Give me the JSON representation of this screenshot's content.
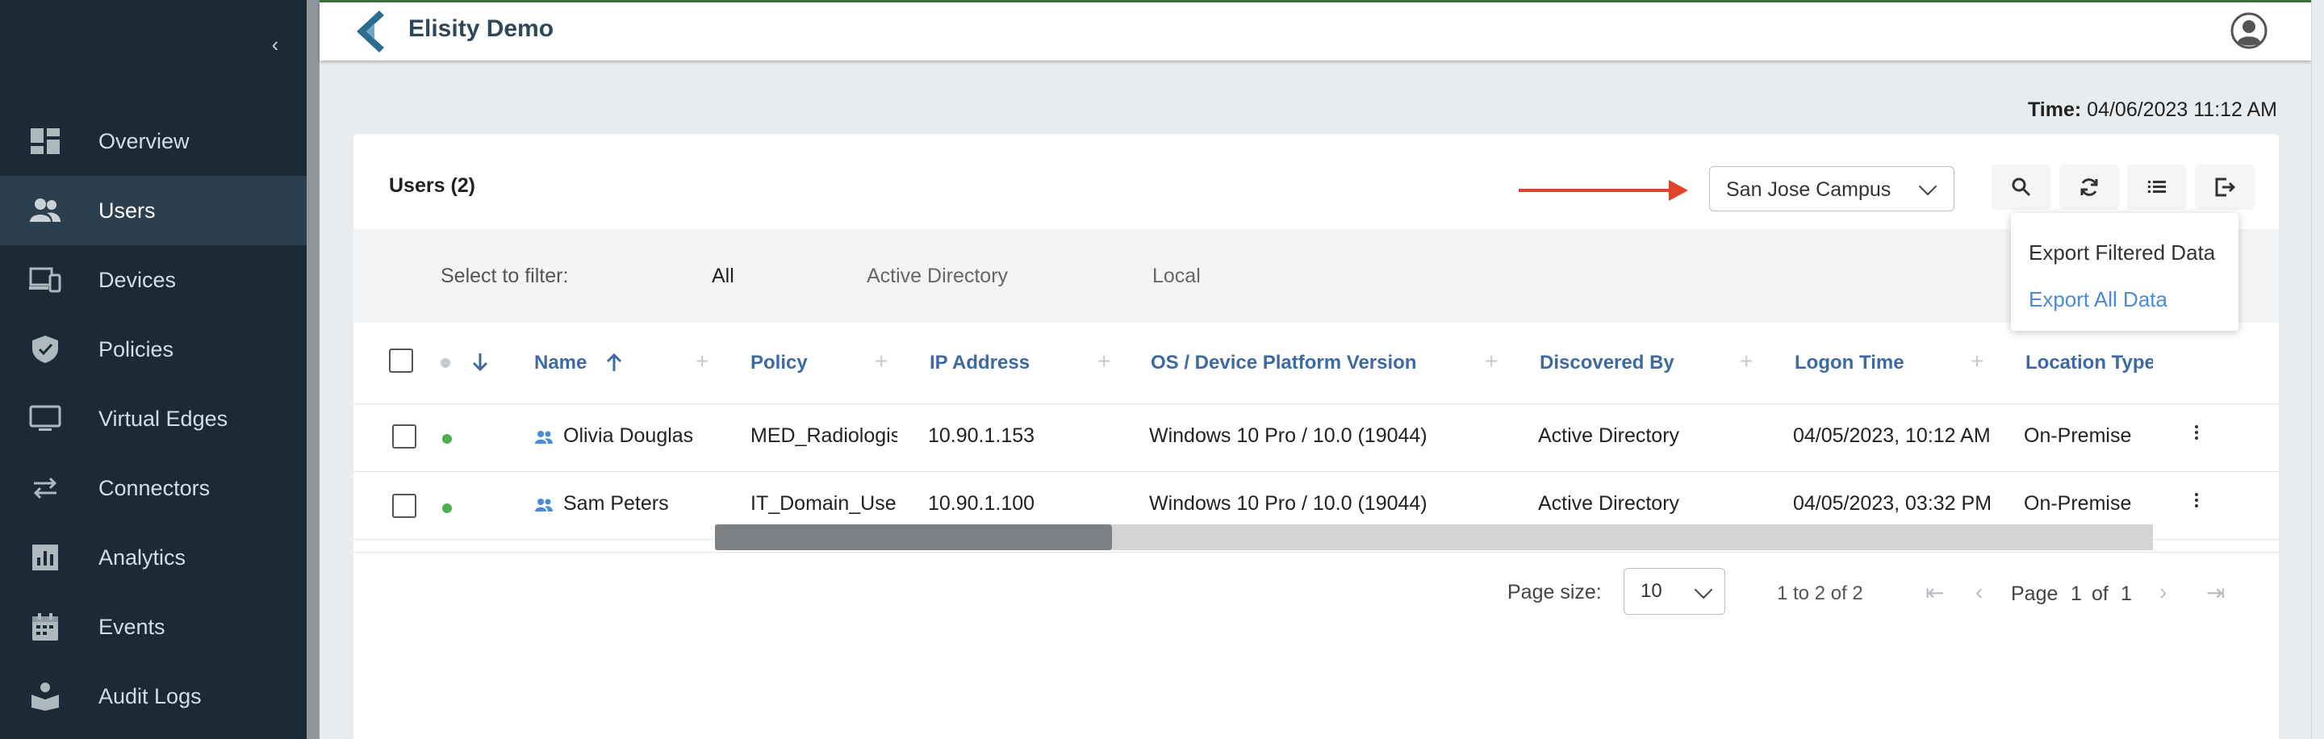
{
  "app": {
    "title": "Elisity Demo"
  },
  "sidebar": {
    "items": [
      {
        "label": "Overview",
        "icon": "dashboard-icon"
      },
      {
        "label": "Users",
        "icon": "users-icon",
        "active": true
      },
      {
        "label": "Devices",
        "icon": "devices-icon"
      },
      {
        "label": "Policies",
        "icon": "shield-icon"
      },
      {
        "label": "Virtual Edges",
        "icon": "monitor-icon"
      },
      {
        "label": "Connectors",
        "icon": "swap-arrows-icon"
      },
      {
        "label": "Analytics",
        "icon": "bar-chart-icon"
      },
      {
        "label": "Events",
        "icon": "calendar-icon"
      },
      {
        "label": "Audit Logs",
        "icon": "book-reader-icon"
      }
    ]
  },
  "time": {
    "label": "Time:",
    "value": "04/06/2023 11:12 AM"
  },
  "panel": {
    "title": "Users (2)",
    "site_select": "San Jose Campus",
    "toolbar": {
      "search": "search-icon",
      "refresh": "refresh-icon",
      "columns": "list-icon",
      "export": "export-icon"
    },
    "export_menu": [
      "Export Filtered Data",
      "Export All Data"
    ]
  },
  "filter": {
    "label": "Select to filter:",
    "tabs": [
      "All",
      "Active Directory",
      "Local"
    ],
    "active_tab": "All"
  },
  "table": {
    "columns": [
      "Name",
      "Policy",
      "IP Address",
      "OS /  Device Platform Version",
      "Discovered By",
      "Logon Time",
      "Location Type"
    ],
    "sort": {
      "column": "Name",
      "direction": "ascending"
    },
    "rows": [
      {
        "name": "Olivia Douglas",
        "policy": "MED_Radiologist",
        "ip": "10.90.1.153",
        "os": "Windows 10 Pro / 10.0 (19044)",
        "discovered_by": "Active Directory",
        "logon_time": "04/05/2023, 10:12 AM",
        "location_type": "On-Premise",
        "status_color": "#4caf50"
      },
      {
        "name": "Sam Peters",
        "policy": "IT_Domain_User",
        "ip": "10.90.1.100",
        "os": "Windows 10 Pro / 10.0 (19044)",
        "discovered_by": "Active Directory",
        "logon_time": "04/05/2023, 03:32 PM",
        "location_type": "On-Premise",
        "status_color": "#4caf50"
      }
    ]
  },
  "pagination": {
    "page_size_label": "Page size:",
    "page_size": "10",
    "range": "1 to 2 of 2",
    "page_label": "Page",
    "page": "1",
    "of_label": "of",
    "total_pages": "1"
  },
  "colors": {
    "accent": "#4a8bd6",
    "sidebar": "#1a2b37",
    "annotation_arrow": "#e0442b"
  }
}
